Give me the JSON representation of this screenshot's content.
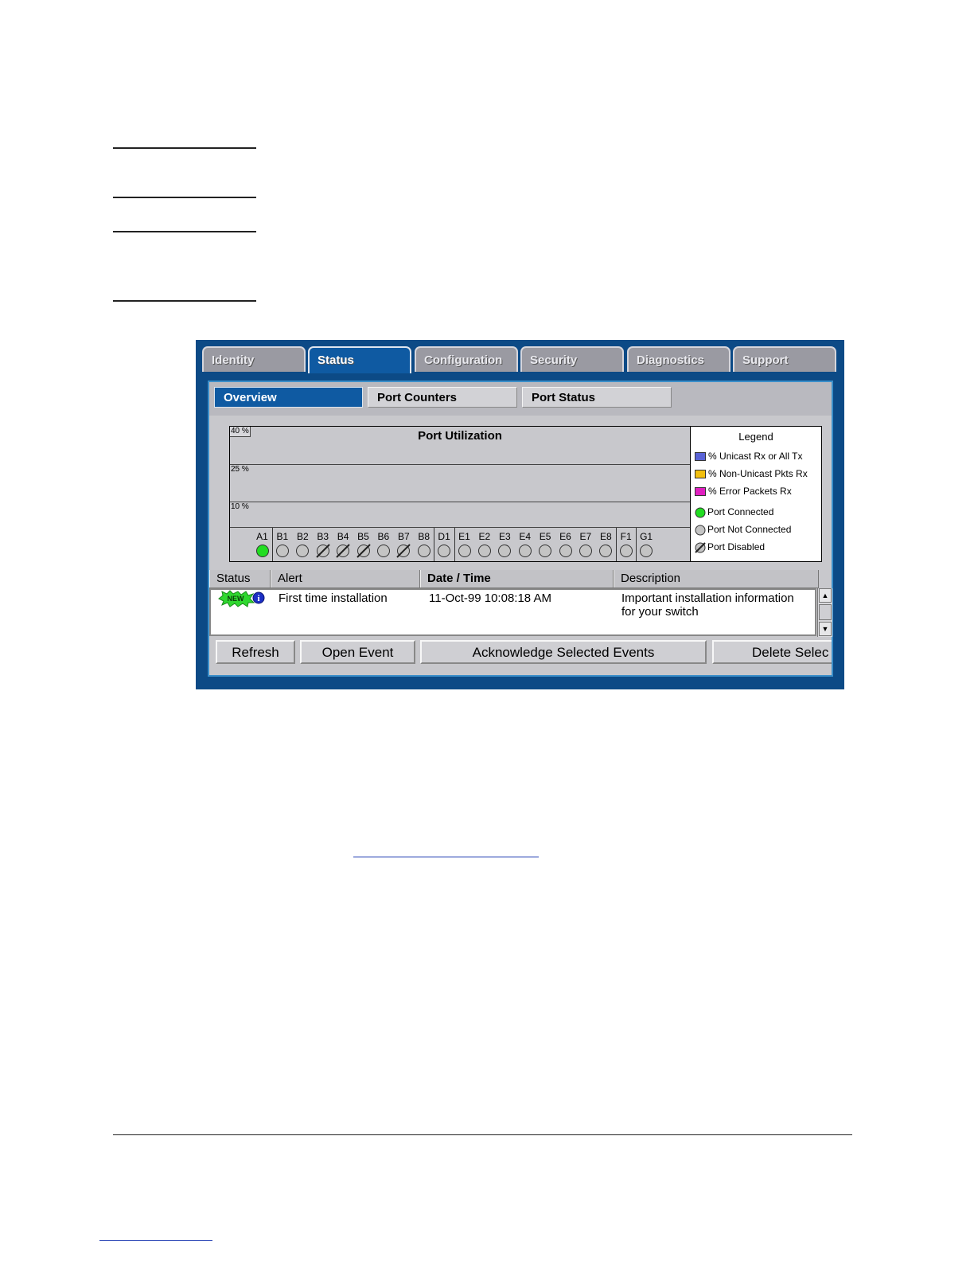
{
  "tabs": [
    "Identity",
    "Status",
    "Configuration",
    "Security",
    "Diagnostics",
    "Support"
  ],
  "active_tab": "Status",
  "subtabs": [
    "Overview",
    "Port Counters",
    "Port Status"
  ],
  "active_subtab": "Overview",
  "chart": {
    "title": "Port Utilization",
    "levels": [
      "40 %",
      "25 %",
      "10 %"
    ]
  },
  "ports": [
    {
      "id": "A1",
      "state": "connected"
    },
    {
      "id": "B1",
      "state": "not-connected"
    },
    {
      "id": "B2",
      "state": "not-connected"
    },
    {
      "id": "B3",
      "state": "disabled"
    },
    {
      "id": "B4",
      "state": "disabled"
    },
    {
      "id": "B5",
      "state": "disabled"
    },
    {
      "id": "B6",
      "state": "not-connected"
    },
    {
      "id": "B7",
      "state": "disabled"
    },
    {
      "id": "B8",
      "state": "not-connected"
    },
    {
      "id": "D1",
      "state": "not-connected"
    },
    {
      "id": "E1",
      "state": "not-connected"
    },
    {
      "id": "E2",
      "state": "not-connected"
    },
    {
      "id": "E3",
      "state": "not-connected"
    },
    {
      "id": "E4",
      "state": "not-connected"
    },
    {
      "id": "E5",
      "state": "not-connected"
    },
    {
      "id": "E6",
      "state": "not-connected"
    },
    {
      "id": "E7",
      "state": "not-connected"
    },
    {
      "id": "E8",
      "state": "not-connected"
    },
    {
      "id": "F1",
      "state": "not-connected"
    },
    {
      "id": "G1",
      "state": "not-connected"
    }
  ],
  "legend": {
    "title": "Legend",
    "items": [
      {
        "label": "% Unicast Rx or All Tx",
        "color": "#5a63d6"
      },
      {
        "label": "% Non-Unicast Pkts Rx",
        "color": "#f2c010"
      },
      {
        "label": "% Error Packets Rx",
        "color": "#e020c0"
      }
    ],
    "port_states": [
      {
        "label": "Port Connected",
        "icon": "port-connected-icon"
      },
      {
        "label": "Port Not Connected",
        "icon": "port-not-connected-icon"
      },
      {
        "label": "Port Disabled",
        "icon": "port-disabled-icon"
      }
    ]
  },
  "events": {
    "columns": [
      "Status",
      "Alert",
      "Date / Time",
      "Description"
    ],
    "rows": [
      {
        "status_badge": "NEW",
        "status_icon": "info-icon",
        "alert": "First time installation",
        "datetime": "11-Oct-99 10:08:18 AM",
        "description_line1": "Important installation information",
        "description_line2": "for your switch"
      }
    ]
  },
  "buttons": [
    "Refresh",
    "Open Event",
    "Acknowledge Selected Events",
    "Delete Selec"
  ],
  "colors": {
    "frame": "#0c4a86",
    "accent": "#0f5aa2",
    "connected": "#22dd22",
    "not_connected": "#c4c4c4"
  }
}
